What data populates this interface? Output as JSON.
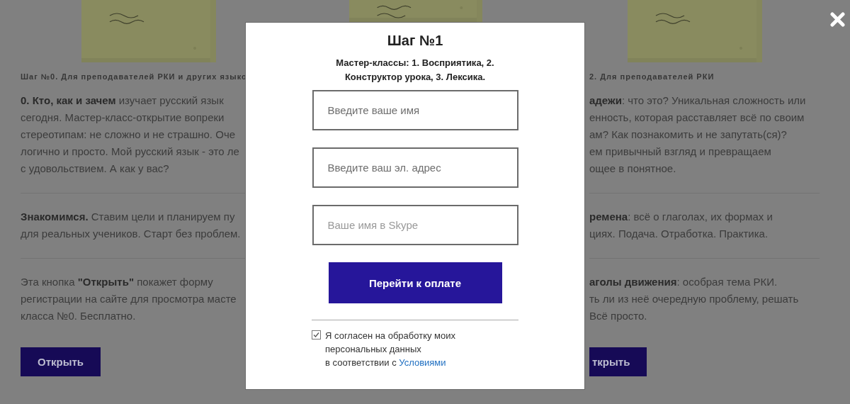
{
  "page": {
    "columns": [
      {
        "note": {
          "kind": "picture"
        },
        "heading": "Шаг №0. Для преподавателей РКИ и других языко",
        "blocks": [
          {
            "lines": [
              "**0. Кто, как и зачем** изучает русский язык",
              "сегодня. Мастер-класс-открытие вопреки",
              "стереотипам: не сложно и не страшно. Оче",
              "логично и просто. Мой русский язык - это ле",
              "с удовольствием. А как у вас?"
            ]
          },
          {
            "lines": [
              "**Знакомимся.** Ставим цели и планируем пу",
              "для реальных учеников. Старт без проблем."
            ]
          },
          {
            "lines": [
              "Эта кнопка **\"Открыть\"** покажет форму",
              "регистрации на сайте для просмотра масте",
              "класса №0. Бесплатно."
            ]
          }
        ],
        "button": "Открыть"
      },
      {
        "note": {
          "kind": "picture"
        }
      },
      {
        "note": {
          "kind": "picture"
        },
        "heading": "2. Для преподавателей РКИ",
        "blocks": [
          {
            "lines": [
              "**адежи**: что это? Уникальная сложность или",
              "енность, которая расставляет всё по своим",
              "ам? Как познакомить и не запутать(ся)?",
              "ем привычный взгляд и превращаем",
              "ощее в понятное."
            ]
          },
          {
            "lines": [
              "**ремена**: всё о глаголах, их формах и",
              "циях. Подача. Отработка. Практика."
            ]
          },
          {
            "lines": [
              "**аголы движения**: особрая тема РКИ.",
              "ть ли из неё очередную проблему, решать",
              "Всё просто."
            ]
          }
        ],
        "button": "ткрыть"
      }
    ]
  },
  "modal": {
    "title": "Шаг №1",
    "subtitle": [
      "Мастер-классы: 1. Восприятика, 2.",
      "Конструктор урока, 3. Лексика."
    ],
    "fields": [
      {
        "placeholder": "Введите ваше имя"
      },
      {
        "placeholder": "Введите ваш эл. адрес"
      },
      {
        "placeholder": "Ваше имя в Skype"
      }
    ],
    "submit": "Перейти к оплате",
    "consent": {
      "checked": true,
      "lines": [
        "Я согласен на обработку моих",
        "персональных данных",
        "в соответствии с"
      ],
      "link": "Условиями"
    }
  }
}
